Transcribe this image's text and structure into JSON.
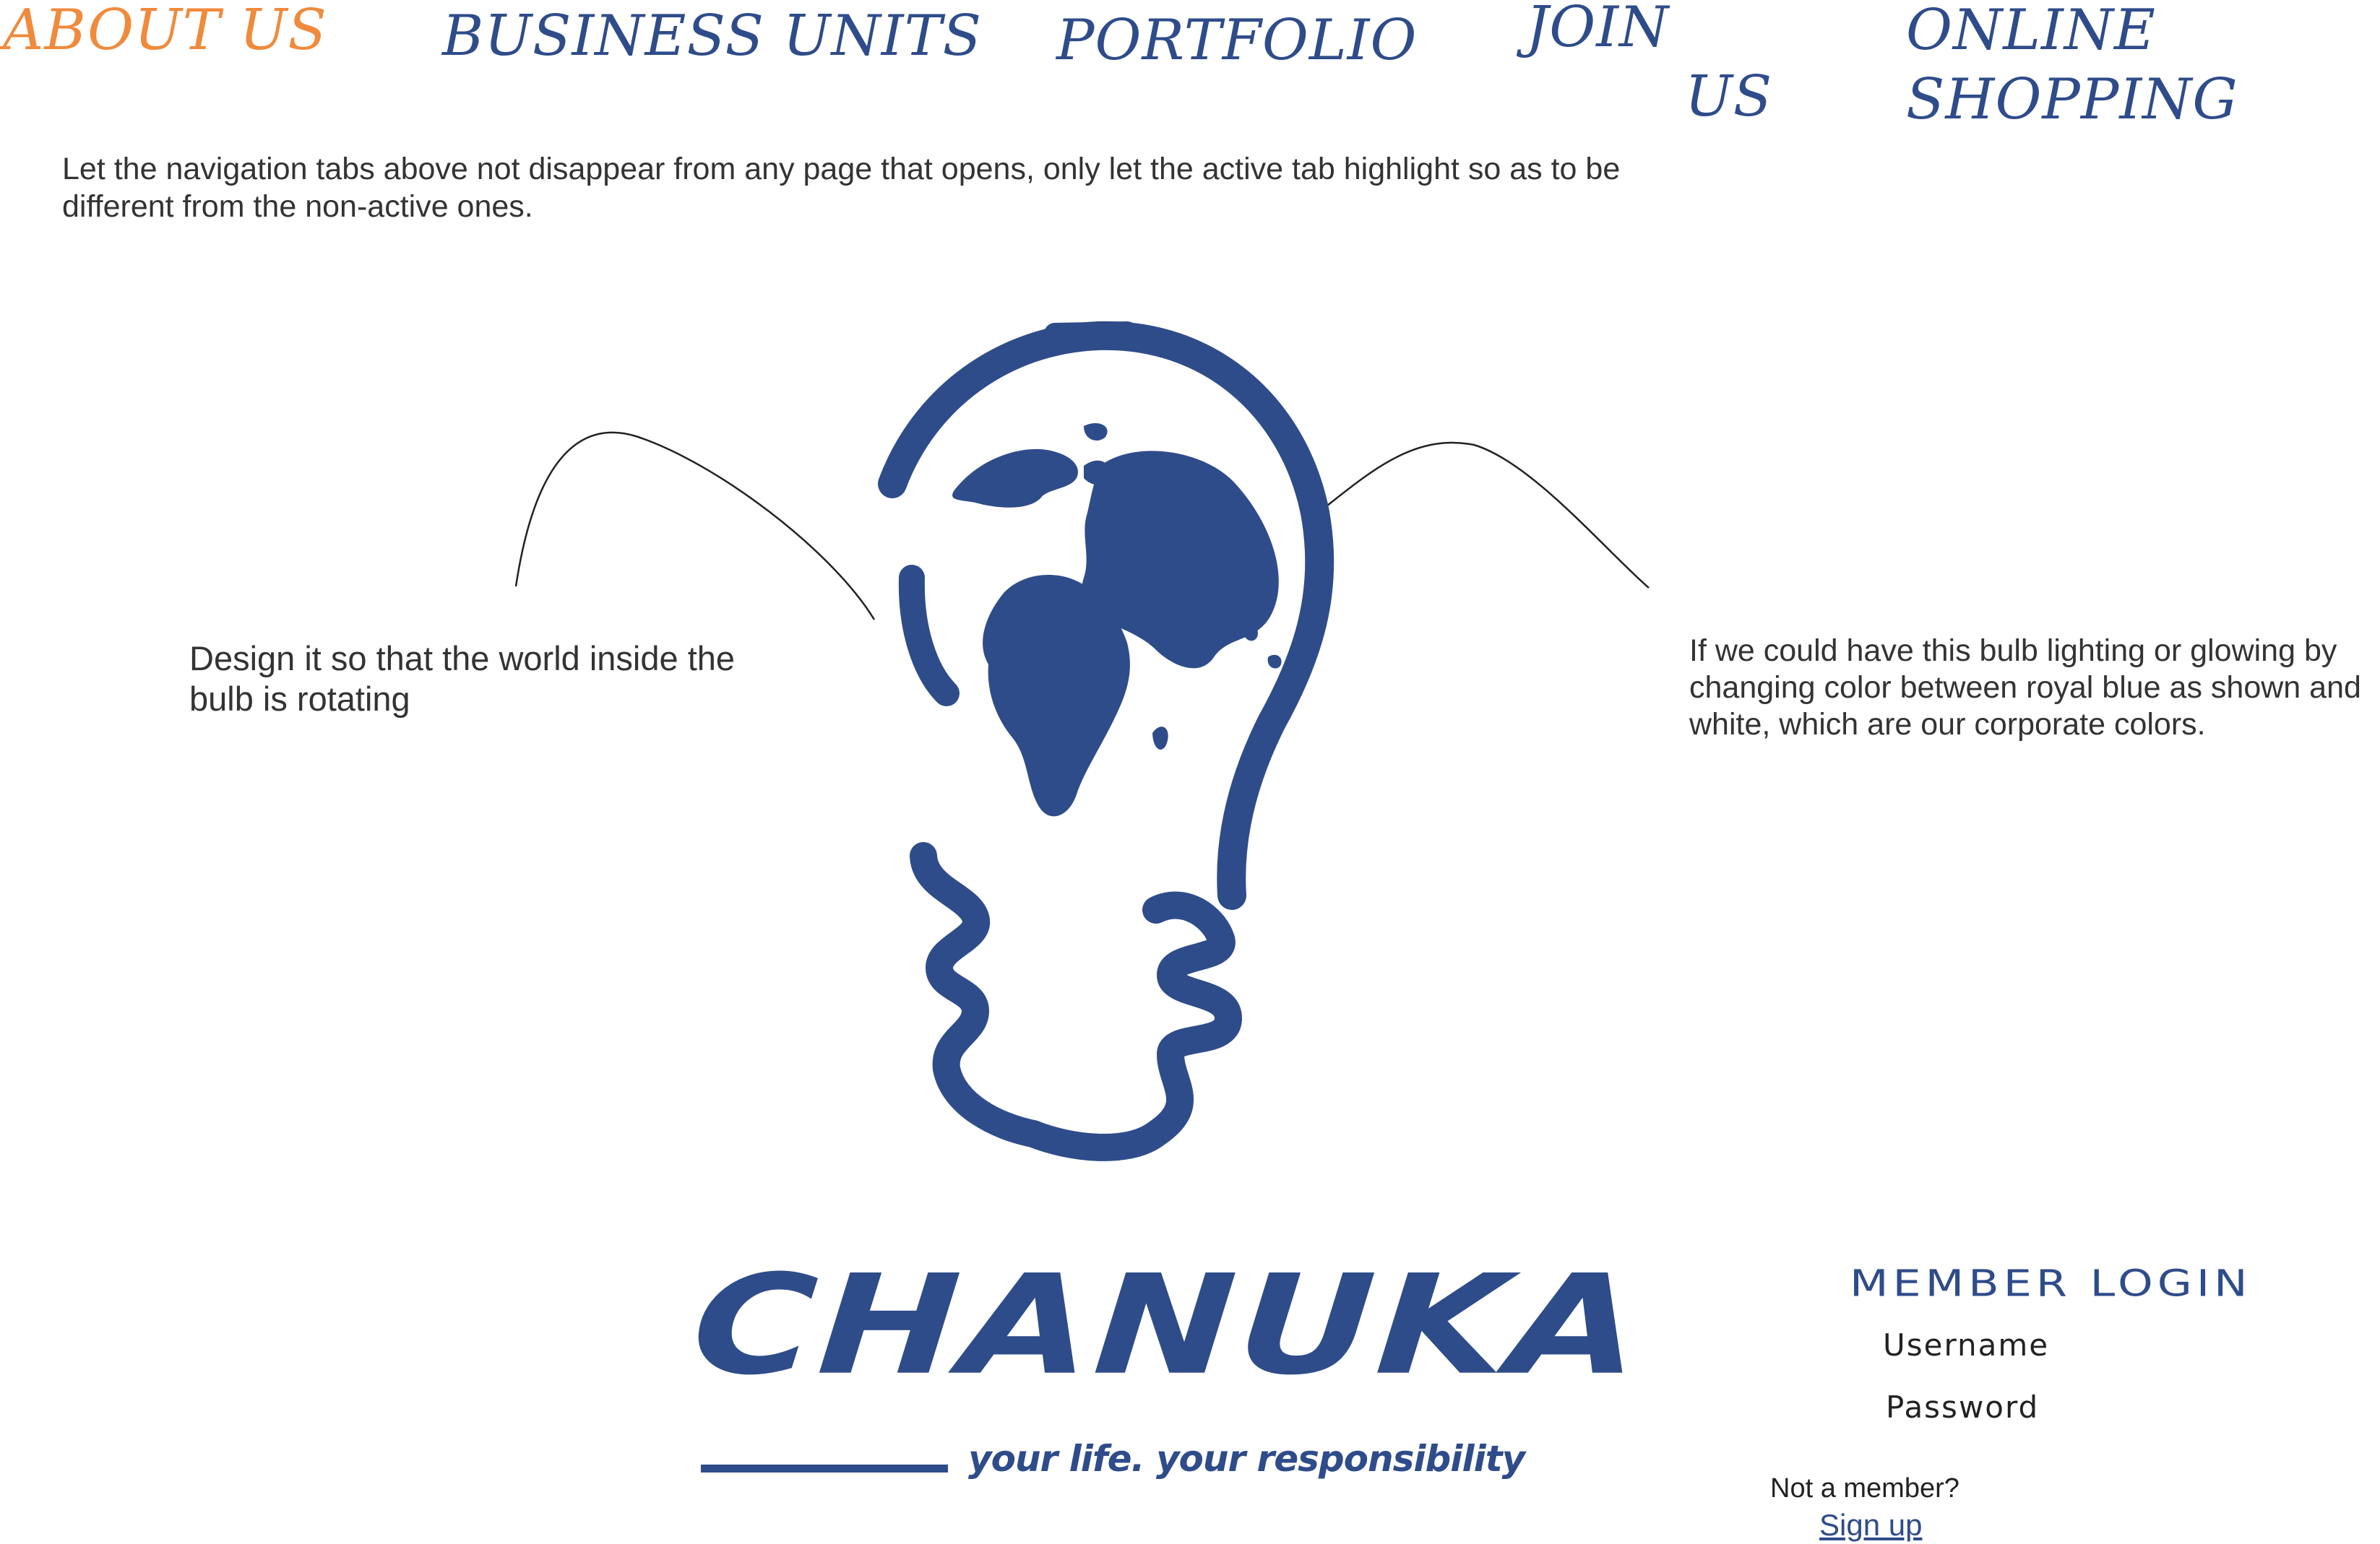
{
  "nav": {
    "tabs": [
      {
        "id": "about",
        "lines": [
          "ABOUT US"
        ],
        "active": true
      },
      {
        "id": "business",
        "lines": [
          "BUSINESS UNITS"
        ],
        "active": false
      },
      {
        "id": "portfolio",
        "lines": [
          "PORTFOLIO"
        ],
        "active": false
      },
      {
        "id": "join",
        "lines": [
          "JOIN",
          "US"
        ],
        "active": false
      },
      {
        "id": "online",
        "lines": [
          "ONLINE",
          "SHOPPING"
        ],
        "active": false
      }
    ]
  },
  "notes": {
    "nav_note": "Let the navigation tabs above not disappear from any page that opens, only let the active tab highlight so as to be different from the non-active ones.",
    "rotate_note": "Design it so that the world inside the bulb is rotating",
    "glow_note": "If we could have this bulb lighting or glowing by changing color between royal blue as shown and white, which are our corporate colors."
  },
  "logo": {
    "name": "CHANUKA",
    "tagline": "your life. your responsibility"
  },
  "login": {
    "title": "MEMBER LOGIN",
    "username_label": "Username",
    "password_label": "Password",
    "not_member": "Not a member?",
    "signup": "Sign up"
  },
  "colors": {
    "brand_blue": "#2f4c8a",
    "active_tab": "#f08a3c",
    "text": "#333333"
  },
  "icons": {
    "bulb": "lightbulb-globe-icon"
  }
}
